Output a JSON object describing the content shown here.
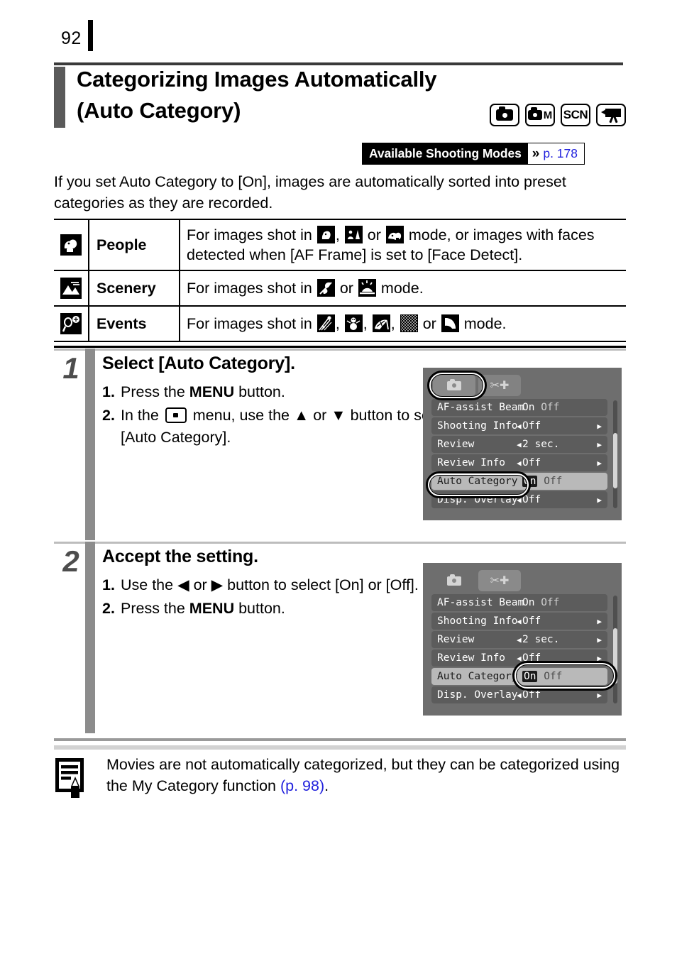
{
  "page": {
    "number": "92"
  },
  "header": {
    "title_line1": "Categorizing Images Automatically",
    "title_line2": "(Auto Category)",
    "mode_icons": [
      {
        "name": "camera-auto-mode-icon",
        "label": ""
      },
      {
        "name": "camera-manual-mode-icon",
        "label": "M"
      },
      {
        "name": "scn-mode-icon",
        "label": "SCN"
      },
      {
        "name": "movie-mode-icon",
        "label": ""
      }
    ],
    "available_modes": {
      "label": "Available Shooting Modes",
      "chevron": "»",
      "page_ref": "p. 178"
    }
  },
  "intro": "If you set Auto Category to [On], images are automatically sorted into preset categories as they are recorded.",
  "category_table": {
    "rows": [
      {
        "icon": "people-category-icon",
        "name": "People",
        "desc_prefix": "For images shot in",
        "desc_middle": ", ",
        "desc_or": " or ",
        "desc_suffix": " mode, or images with faces detected when [AF Frame] is set to [Face Detect].",
        "mode_icons": [
          "portrait-mode-icon",
          "night-snapshot-mode-icon",
          "kids-and-pets-mode-icon"
        ]
      },
      {
        "icon": "scenery-category-icon",
        "name": "Scenery",
        "desc_prefix": "For images shot in",
        "desc_or": " or ",
        "desc_suffix": " mode.",
        "mode_icons": [
          "foliage-mode-icon",
          "sunset-mode-icon"
        ]
      },
      {
        "icon": "events-category-icon",
        "name": "Events",
        "desc_prefix": "For images shot in",
        "desc_or": " or ",
        "desc_suffix": " mode.",
        "mode_icons": [
          "fireworks-mode-icon",
          "snow-mode-icon",
          "beach-mode-icon",
          "aquarium-mode-icon",
          "indoor-mode-icon"
        ]
      }
    ]
  },
  "steps": [
    {
      "number": "1",
      "heading": "Select [Auto Category].",
      "substeps": [
        {
          "num": "1.",
          "pre": "Press the ",
          "bold": "MENU",
          "post": " button."
        },
        {
          "num": "2.",
          "pre": "In the ",
          "bold": "",
          "post": " menu, use the ▲ or ▼ button to select [Auto Category]."
        }
      ]
    },
    {
      "number": "2",
      "heading": "Accept the setting.",
      "substeps": [
        {
          "num": "1.",
          "pre": "Use the ◀ or ▶ button to select [On] or [Off].",
          "bold": "",
          "post": ""
        },
        {
          "num": "2.",
          "pre": "Press the ",
          "bold": "MENU",
          "post": " button."
        }
      ]
    }
  ],
  "screenshots": [
    {
      "name": "menu-screenshot-step1",
      "tabs": [
        {
          "name": "shooting-tab",
          "icon": "camera-icon",
          "active": true
        },
        {
          "name": "setup-tab",
          "icon": "wrench-hammer-icon",
          "active": false
        }
      ],
      "rows": [
        {
          "label": "AF-assist Beam",
          "value_on": "On",
          "value_off": "Off",
          "style": "onoff",
          "selected": false
        },
        {
          "label": "Shooting Info",
          "value": "Off",
          "style": "carets",
          "selected": false
        },
        {
          "label": "Review",
          "value": "2 sec.",
          "style": "carets",
          "selected": false
        },
        {
          "label": "Review Info",
          "value": "Off",
          "style": "carets",
          "selected": false
        },
        {
          "label": "Auto Category",
          "value_on": "On",
          "value_off": "Off",
          "style": "onoff",
          "selected": true
        },
        {
          "label": "Disp. Overlay",
          "value": "Off",
          "style": "carets",
          "selected": false
        }
      ],
      "highlights": [
        "shooting-tab-highlight",
        "auto-category-label-highlight"
      ]
    },
    {
      "name": "menu-screenshot-step2",
      "tabs": [
        {
          "name": "shooting-tab",
          "icon": "camera-icon",
          "active": false
        },
        {
          "name": "setup-tab",
          "icon": "wrench-hammer-icon",
          "active": true
        }
      ],
      "rows": [
        {
          "label": "AF-assist Beam",
          "value_on": "On",
          "value_off": "Off",
          "style": "onoff",
          "selected": false
        },
        {
          "label": "Shooting Info",
          "value": "Off",
          "style": "carets",
          "selected": false
        },
        {
          "label": "Review",
          "value": "2 sec.",
          "style": "carets",
          "selected": false
        },
        {
          "label": "Review Info",
          "value": "Off",
          "style": "carets",
          "selected": false
        },
        {
          "label": "Auto Category",
          "value_on": "On",
          "value_off": "Off",
          "style": "onoff",
          "selected": true
        },
        {
          "label": "Disp. Overlay",
          "value": "Off",
          "style": "carets",
          "selected": false
        }
      ],
      "highlights": [
        "auto-category-value-highlight"
      ]
    }
  ],
  "note": {
    "icon": "note-pencil-icon",
    "text_before": "Movies are not automatically categorized, but they can be categorized using the My Category function ",
    "link": "(p. 98)",
    "text_after": "."
  },
  "colors": {
    "link_blue": "#2222dd",
    "step_bar_gray": "#8c8c8c",
    "title_bar_gray": "#5a5a5a",
    "menu_bg": "#6e6e6e",
    "menu_row": "#5c5c5c",
    "menu_row_selected": "#b9b9b9"
  }
}
